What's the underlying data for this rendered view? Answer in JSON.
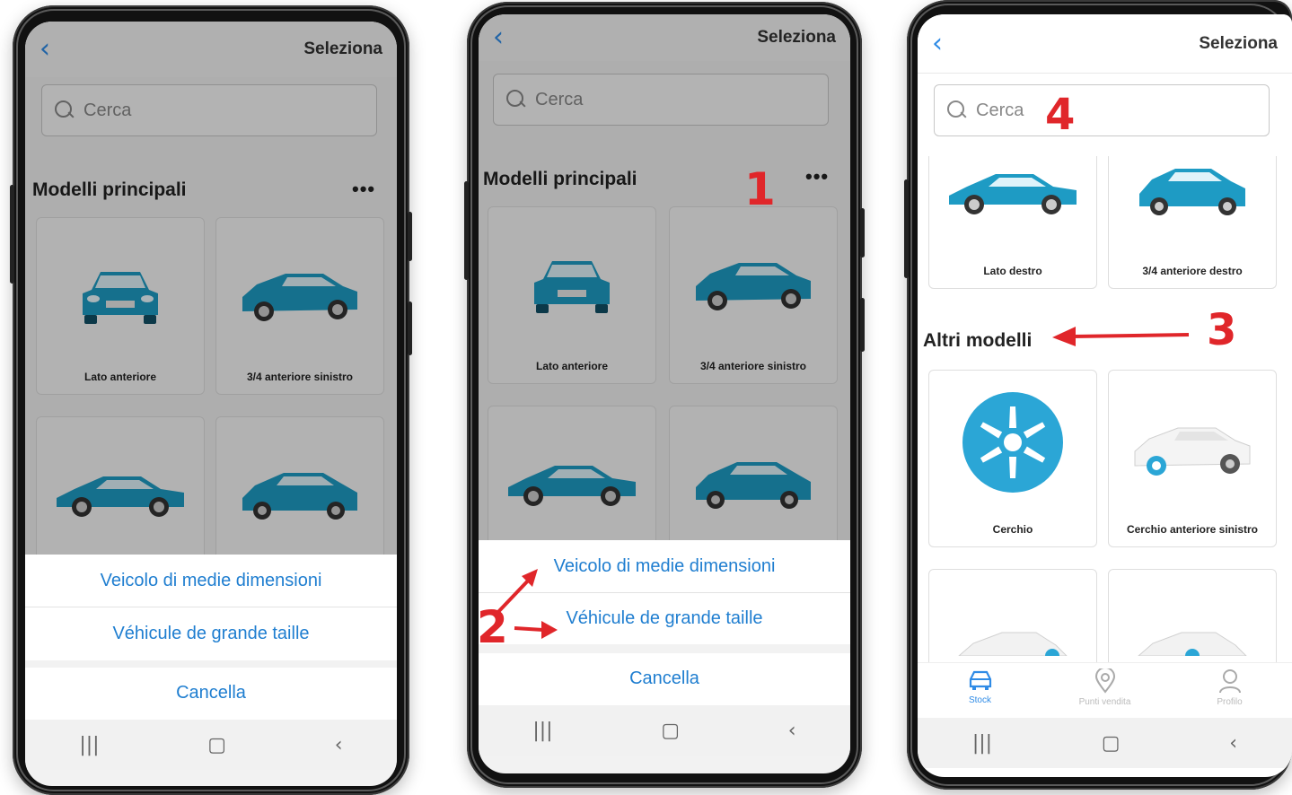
{
  "colors": {
    "accent": "#2f8be6",
    "car": "#1e9bc4",
    "annotation": "#e0262a"
  },
  "phone1": {
    "title": "Seleziona",
    "search_placeholder": "Cerca",
    "section": "Modelli principali",
    "menu": "•••",
    "cards": [
      "Lato anteriore",
      "3/4 anteriore sinistro"
    ],
    "options": [
      "Veicolo di medie dimensioni",
      "Véhicule de grande taille"
    ],
    "cancel": "Cancella"
  },
  "phone2": {
    "title": "Seleziona",
    "search_placeholder": "Cerca",
    "section": "Modelli principali",
    "menu": "•••",
    "cards": [
      "Lato anteriore",
      "3/4 anteriore sinistro"
    ],
    "options": [
      "Veicolo di medie dimensioni",
      "Véhicule de grande taille"
    ],
    "cancel": "Cancella",
    "annotations": [
      "1",
      "2"
    ]
  },
  "phone3": {
    "title": "Seleziona",
    "search_placeholder": "Cerca",
    "top_cards": [
      "Lato destro",
      "3/4 anteriore destro"
    ],
    "section": "Altri modelli",
    "cards": [
      "Cerchio",
      "Cerchio anteriore sinistro"
    ],
    "tabs": [
      {
        "label": "Stock",
        "icon": "car-icon"
      },
      {
        "label": "Punti vendita",
        "icon": "location-pin-icon"
      },
      {
        "label": "Profilo",
        "icon": "user-icon"
      }
    ],
    "annotations": [
      "3",
      "4"
    ]
  },
  "nav_icons": [
    "recent-apps-icon",
    "home-icon",
    "back-icon"
  ]
}
